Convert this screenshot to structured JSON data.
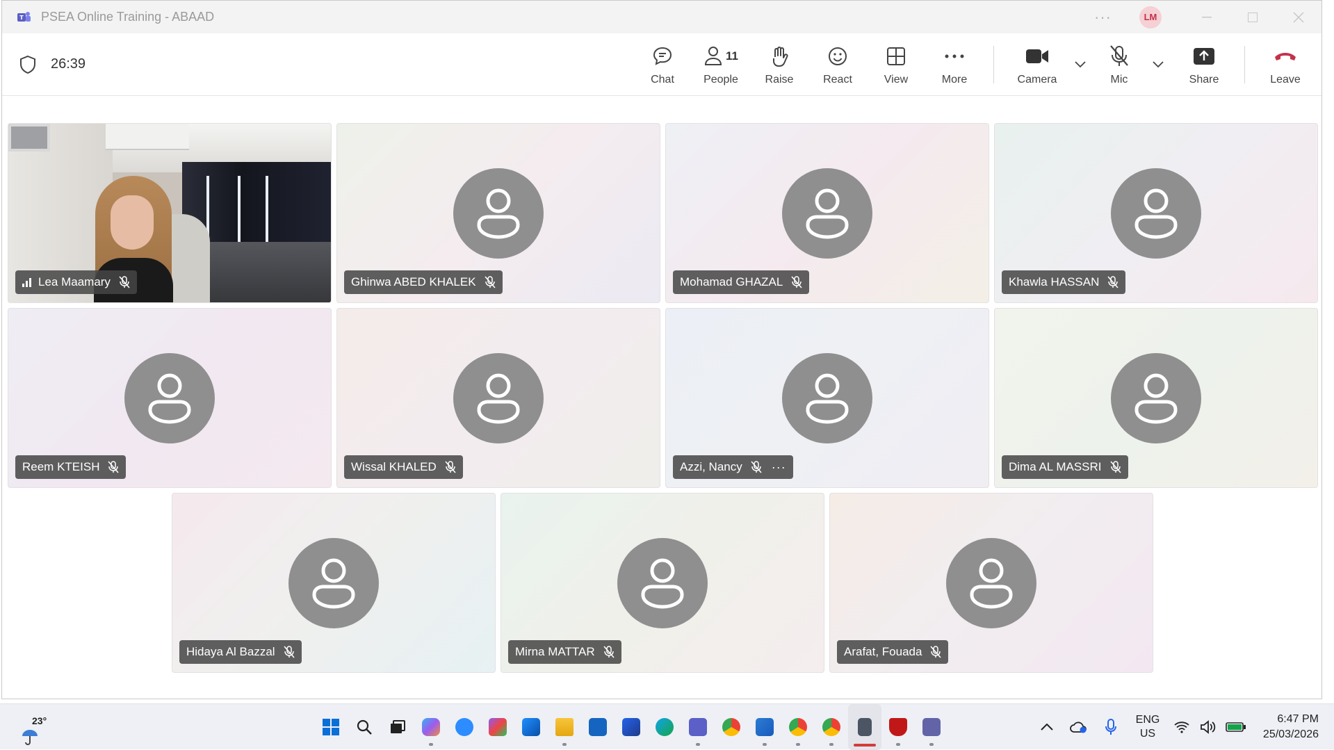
{
  "window": {
    "title": "PSEA Online Training - ABAAD",
    "user_initials": "LM"
  },
  "meeting": {
    "timer": "26:39",
    "toolbar": {
      "chat": "Chat",
      "people": "People",
      "people_count": "11",
      "raise": "Raise",
      "react": "React",
      "view": "View",
      "more": "More",
      "camera": "Camera",
      "mic": "Mic",
      "share": "Share",
      "leave": "Leave"
    }
  },
  "participants": [
    {
      "name": "Lea Maamary",
      "video": true
    },
    {
      "name": "Ghinwa ABED KHALEK"
    },
    {
      "name": "Mohamad GHAZAL"
    },
    {
      "name": "Khawla HASSAN"
    },
    {
      "name": "Reem KTEISH"
    },
    {
      "name": "Wissal KHALED"
    },
    {
      "name": "Azzi, Nancy",
      "more": "···"
    },
    {
      "name": "Dima AL MASSRI"
    },
    {
      "name": "Hidaya Al Bazzal"
    },
    {
      "name": "Mirna MATTAR"
    },
    {
      "name": "Arafat, Fouada"
    }
  ],
  "taskbar": {
    "weather_temp": "23°",
    "lang_primary": "ENG",
    "lang_secondary": "US",
    "time": "6:47 PM",
    "date": "25/03/2026",
    "colors": {
      "accent": "#0067c0",
      "leave": "#c4314b"
    }
  }
}
